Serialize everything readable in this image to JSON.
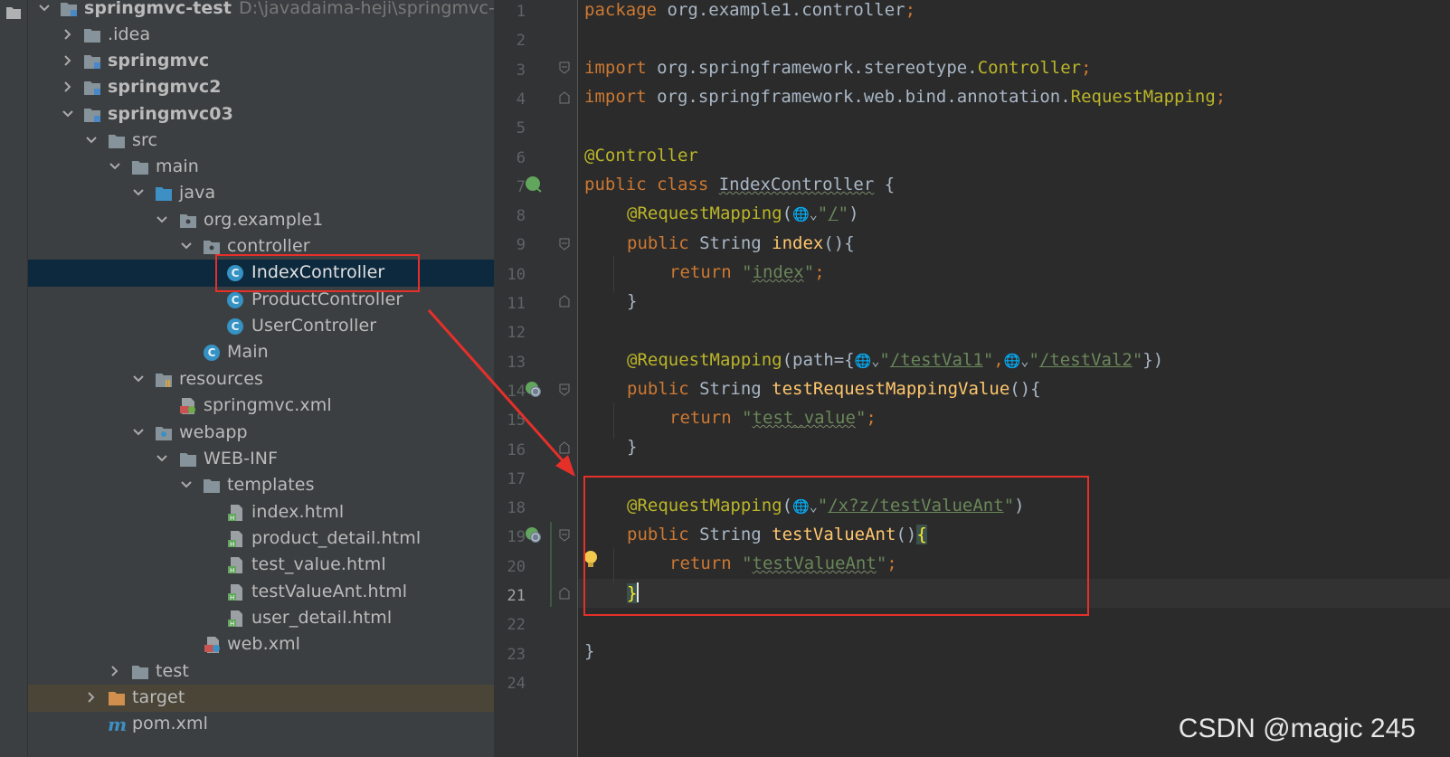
{
  "tree": {
    "root": {
      "name": "springmvc-test",
      "path": "D:\\javadaima-heji\\springmvc-test"
    },
    "idea": ".idea",
    "mod1": "springmvc",
    "mod2": "springmvc2",
    "mod3": "springmvc03",
    "src": "src",
    "main": "main",
    "java": "java",
    "pkg": "org.example1",
    "controller": "controller",
    "index_controller": "IndexController",
    "product_controller": "ProductController",
    "user_controller": "UserController",
    "main_class": "Main",
    "resources": "resources",
    "springmvc_xml": "springmvc.xml",
    "webapp": "webapp",
    "webinf": "WEB-INF",
    "templates": "templates",
    "index_html": "index.html",
    "product_detail_html": "product_detail.html",
    "test_value_html": "test_value.html",
    "test_value_ant_html": "testValueAnt.html",
    "user_detail_html": "user_detail.html",
    "web_xml": "web.xml",
    "test": "test",
    "target": "target",
    "pom": "pom.xml"
  },
  "editor": {
    "current_line": 21,
    "line_numbers": [
      "1",
      "2",
      "3",
      "4",
      "5",
      "6",
      "7",
      "8",
      "9",
      "10",
      "11",
      "12",
      "13",
      "14",
      "15",
      "16",
      "17",
      "18",
      "19",
      "20",
      "21",
      "22",
      "23",
      "24"
    ],
    "tok": {
      "package": "package",
      "pkg_name": " org.example1.controller",
      "semi": ";",
      "import": "import",
      "imp1_path": " org.springframework.stereotype.",
      "imp1_cls": "Controller",
      "imp2_path": " org.springframework.web.bind.annotation.",
      "imp2_cls": "RequestMapping",
      "at_controller": "@Controller",
      "public": "public",
      "class": " class ",
      "class_name": "IndexController",
      "open_brace": " {",
      "close_brace": "}",
      "at_request_mapping": "@RequestMapping",
      "paren_open": "(",
      "paren_close": ")",
      "globe": "🌐⌄",
      "quote": "\"",
      "slash": "/",
      "string_type": " String ",
      "index_fn": "index",
      "fn_brace": "(){",
      "return": "return",
      "index_val": "index",
      "path_eq": "path={",
      "test_val1": "/testVal1",
      "comma": ",",
      "test_val2": "/testVal2",
      "close_set": "})",
      "trv_fn": "testRequestMappingValue",
      "test_value_str": "test_value",
      "ant_path": "/x?z/testValueAnt",
      "tva_fn": "testValueAnt",
      "tva_parens": "()",
      "brace_open_hl": "{",
      "tva_val": "testValueAnt"
    }
  },
  "watermark": "CSDN @magic 245",
  "colors": {
    "keyword": "#cc7832",
    "annotation": "#bbb529",
    "string": "#6a8759",
    "function": "#ffc66d",
    "plain": "#a9b7c6",
    "highlight_box": "#e5302a",
    "selection": "#0d293e"
  }
}
